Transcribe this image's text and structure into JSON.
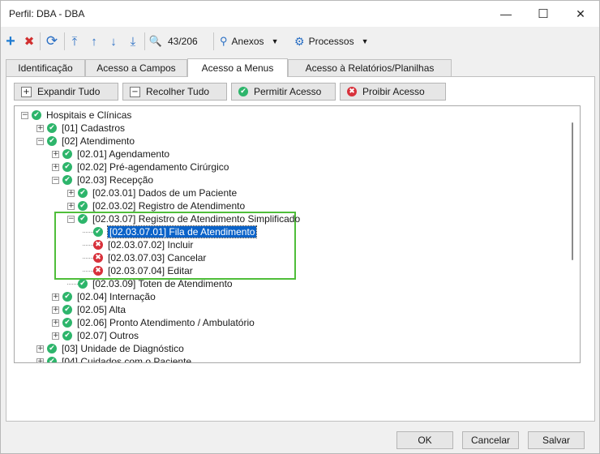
{
  "window": {
    "title": "Perfil: DBA - DBA",
    "minimize_icon": "—",
    "maximize_icon": "☐",
    "close_icon": "✕"
  },
  "toolbar": {
    "add_icon": "+",
    "delete_icon": "✖",
    "refresh_icon": "⟳",
    "first_icon": "⤒",
    "prev_icon": "↑",
    "next_icon": "↓",
    "last_icon": "⤓",
    "search_icon": "🔍",
    "record_counter": "43/206",
    "attachments_label": "Anexos",
    "processes_label": "Processos",
    "colors": {
      "add": "#1e7bd1",
      "delete": "#d12f2f",
      "nav": "#2a6fc4"
    }
  },
  "tabs": [
    {
      "label": "Identificação"
    },
    {
      "label": "Acesso a Campos"
    },
    {
      "label": "Acesso a Menus"
    },
    {
      "label": "Acesso à Relatórios/Planilhas"
    }
  ],
  "actions": {
    "expand_all": "Expandir Tudo",
    "collapse_all": "Recolher Tudo",
    "allow_access": "Permitir Acesso",
    "deny_access": "Proibir Acesso"
  },
  "tree": [
    {
      "label": "Hospitais e Clínicas",
      "status": "allowed",
      "expander": "−",
      "level": 0
    },
    {
      "label": "[01] Cadastros",
      "status": "allowed",
      "expander": "+",
      "level": 1
    },
    {
      "label": "[02] Atendimento",
      "status": "allowed",
      "expander": "−",
      "level": 1
    },
    {
      "label": "[02.01] Agendamento",
      "status": "allowed",
      "expander": "+",
      "level": 2
    },
    {
      "label": "[02.02] Pré-agendamento Cirúrgico",
      "status": "allowed",
      "expander": "+",
      "level": 2
    },
    {
      "label": "[02.03] Recepção",
      "status": "allowed",
      "expander": "−",
      "level": 2
    },
    {
      "label": "[02.03.01] Dados de um Paciente",
      "status": "allowed",
      "expander": "+",
      "level": 3
    },
    {
      "label": "[02.03.02] Registro de Atendimento",
      "status": "allowed",
      "expander": "+",
      "level": 3
    },
    {
      "label": "[02.03.07] Registro de Atendimento Simplificado",
      "status": "allowed",
      "expander": "−",
      "level": 3
    },
    {
      "label": "[02.03.07.01] Fila de Atendimento",
      "status": "allowed",
      "expander": "",
      "level": 4,
      "selected": true
    },
    {
      "label": "[02.03.07.02] Incluir",
      "status": "denied",
      "expander": "",
      "level": 4
    },
    {
      "label": "[02.03.07.03] Cancelar",
      "status": "denied",
      "expander": "",
      "level": 4
    },
    {
      "label": "[02.03.07.04] Editar",
      "status": "denied",
      "expander": "",
      "level": 4
    },
    {
      "label": "[02.03.09] Toten de Atendimento",
      "status": "allowed",
      "expander": "",
      "level": 3
    },
    {
      "label": "[02.04] Internação",
      "status": "allowed",
      "expander": "+",
      "level": 2
    },
    {
      "label": "[02.05] Alta",
      "status": "allowed",
      "expander": "+",
      "level": 2
    },
    {
      "label": "[02.06] Pronto Atendimento / Ambulatório",
      "status": "allowed",
      "expander": "+",
      "level": 2
    },
    {
      "label": "[02.07] Outros",
      "status": "allowed",
      "expander": "+",
      "level": 2
    },
    {
      "label": "[03] Unidade de Diagnóstico",
      "status": "allowed",
      "expander": "+",
      "level": 1
    },
    {
      "label": "[04] Cuidados com o Paciente",
      "status": "allowed",
      "expander": "+",
      "level": 1
    }
  ],
  "status_icons": {
    "allowed": "✔",
    "denied": "✖"
  },
  "colors": {
    "allowed": "#2db56b",
    "denied": "#d8313b",
    "selection": "#0b63c9",
    "highlight_box": "#4fbe3a"
  },
  "footer": {
    "ok": "OK",
    "cancel": "Cancelar",
    "save": "Salvar"
  }
}
